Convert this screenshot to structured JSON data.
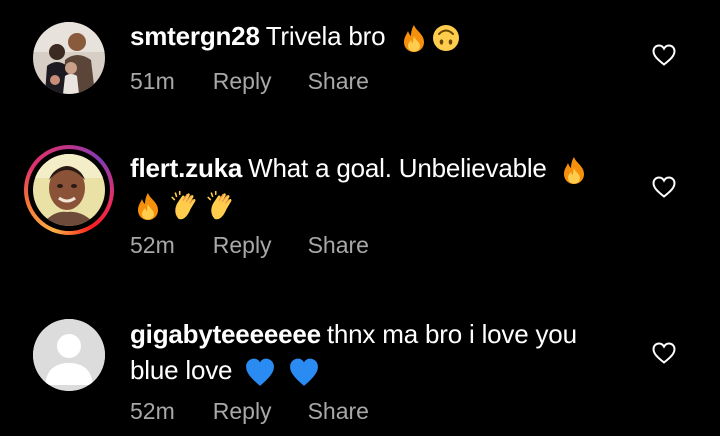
{
  "comments": [
    {
      "username": "smtergn28",
      "text": "Trivela bro",
      "emojis": [
        "fire-emoji",
        "upside-down-face-emoji"
      ],
      "time": "51m",
      "reply_label": "Reply",
      "share_label": "Share",
      "has_story_ring": false
    },
    {
      "username": "flert.zuka",
      "text": "What a goal. Unbelievable",
      "emojis": [
        "fire-emoji",
        "fire-emoji",
        "clapping-hands-emoji",
        "clapping-hands-emoji"
      ],
      "time": "52m",
      "reply_label": "Reply",
      "share_label": "Share",
      "has_story_ring": true
    },
    {
      "username": "gigabyteeeeeee",
      "text": "thnx ma bro i love you blue love",
      "emojis": [
        "blue-heart-emoji",
        "blue-heart-emoji"
      ],
      "time": "52m",
      "reply_label": "Reply",
      "share_label": "Share",
      "has_story_ring": false
    }
  ],
  "colors": {
    "background": "#000000",
    "text": "#ffffff",
    "meta_text": "#a8a8a8",
    "story_ring": [
      "#fcaf45",
      "#e1306c",
      "#833ab4"
    ]
  }
}
